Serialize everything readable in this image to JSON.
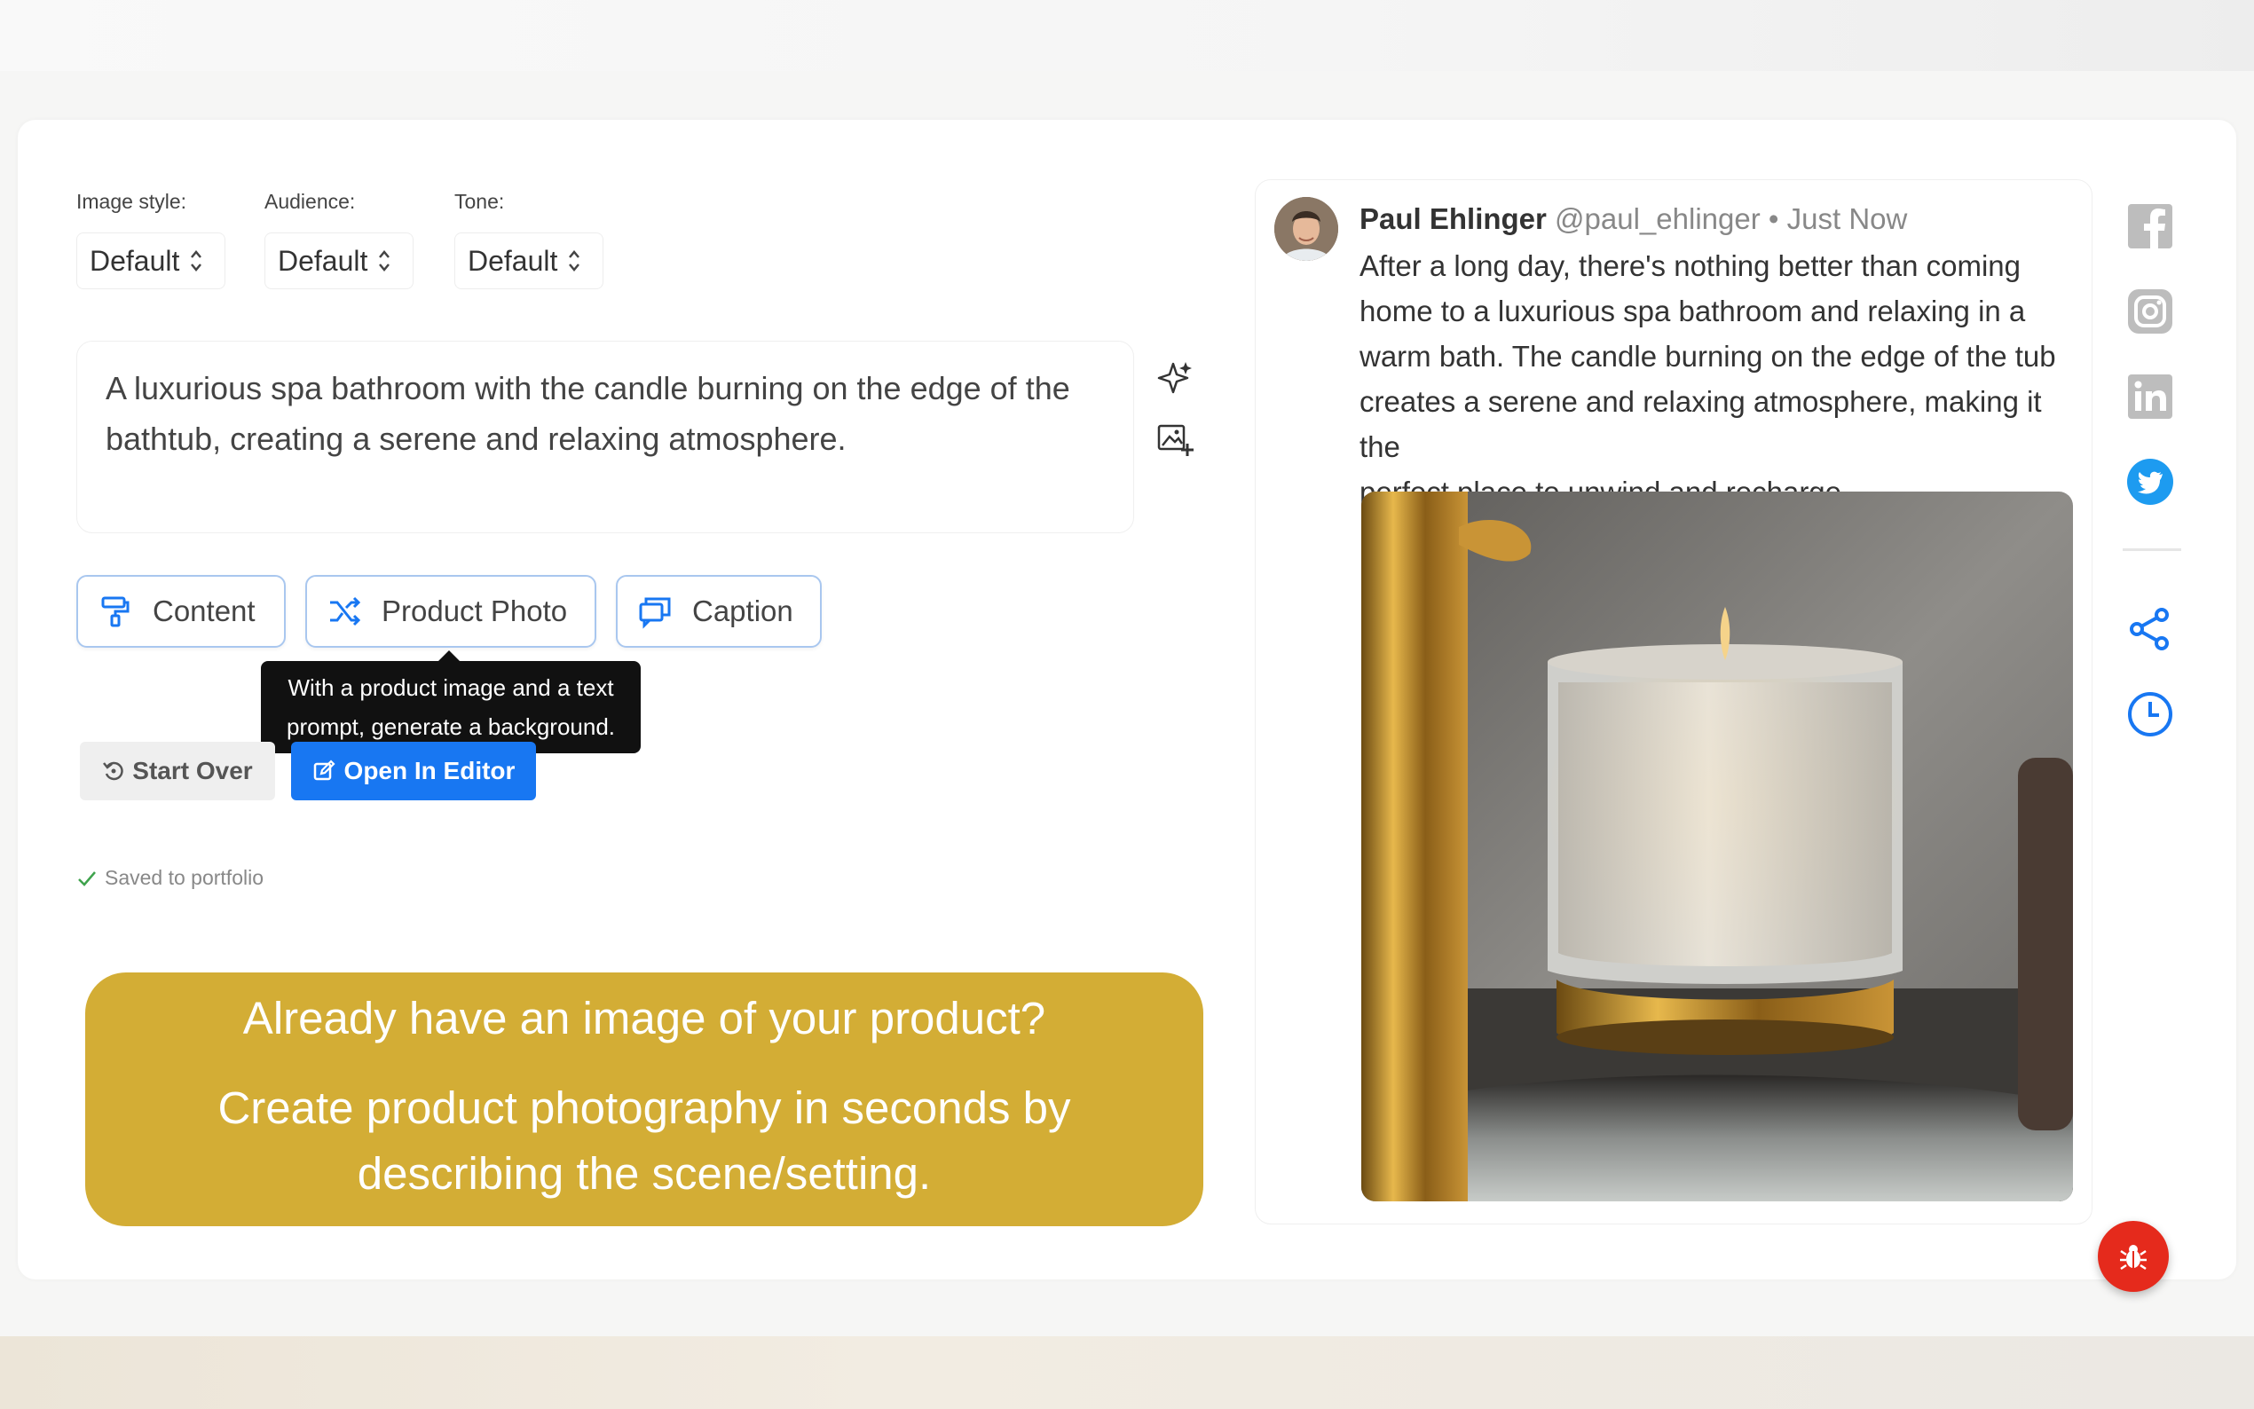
{
  "controls": {
    "image_style": {
      "label": "Image style:",
      "value": "Default"
    },
    "audience": {
      "label": "Audience:",
      "value": "Default"
    },
    "tone": {
      "label": "Tone:",
      "value": "Default"
    }
  },
  "prompt": {
    "line1": "A luxurious spa bathroom with the candle burning on the edge of the",
    "line2": "bathtub, creating a serene and relaxing atmosphere."
  },
  "modes": {
    "content": "Content",
    "product_photo": "Product Photo",
    "caption": "Caption"
  },
  "tooltip": {
    "line1": "With a product image and a text",
    "line2": "prompt, generate a background."
  },
  "actions": {
    "start_over": "Start Over",
    "open_in_editor": "Open In Editor"
  },
  "status": {
    "saved": "Saved to portfolio"
  },
  "banner": {
    "line1": "Already have an image of your product?",
    "line2": "Create product photography in seconds by",
    "line3": "describing the scene/setting."
  },
  "post": {
    "author_name": "Paul Ehlinger",
    "author_handle": "@paul_ehlinger",
    "separator": "•",
    "time": "Just Now",
    "lines": [
      "After a long day, there's nothing better than coming",
      "home to a luxurious spa bathroom and relaxing in a",
      "warm bath. The candle burning on the edge of the tub",
      "creates a serene and relaxing atmosphere, making it the",
      "perfect place to unwind and recharge."
    ]
  },
  "icons": {
    "facebook": "facebook-icon",
    "instagram": "instagram-icon",
    "linkedin": "linkedin-icon",
    "twitter": "twitter-icon",
    "share": "share-icon",
    "history": "clock-icon",
    "bug": "bug-icon"
  },
  "colors": {
    "primary": "#1877f2",
    "banner": "#d3ad35",
    "twitter": "#1d9bf0",
    "bug": "#e52a1c",
    "social_gray": "#bdbdbd"
  }
}
